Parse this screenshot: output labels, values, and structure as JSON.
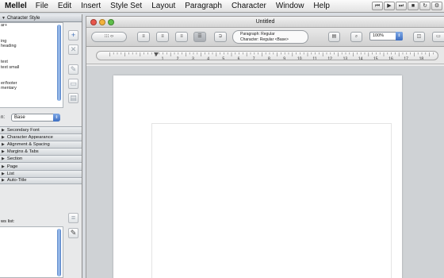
{
  "menubar": {
    "app": "Mellel",
    "items": [
      "File",
      "Edit",
      "Insert",
      "Style Set",
      "Layout",
      "Paragraph",
      "Character",
      "Window",
      "Help"
    ],
    "tray": [
      "⏮",
      "▶",
      "⏭",
      "■",
      "↻",
      "⚙"
    ]
  },
  "palette": {
    "header": "Character Style",
    "styles": [
      "ar+",
      "",
      "",
      "ing",
      "heading",
      "",
      "",
      "text",
      "text small",
      "",
      "",
      "er/footer",
      "mentary"
    ],
    "based_on_label": "n:",
    "based_on_value": "Base",
    "sections": [
      "Secondary Font",
      "Character Appearance",
      "Alignment & Spacing",
      "Margins & Tabs",
      "Section",
      "Page",
      "List",
      "Auto-Title"
    ],
    "list2_title": "ws list:"
  },
  "window": {
    "title": "Untitled",
    "paragraph_style": "Paragraph: Regular",
    "character_style": "Character: Regular <Base>",
    "zoom": "100%"
  },
  "ruler": {
    "numbers": [
      "1",
      "2",
      "3",
      "4",
      "5",
      "6",
      "7",
      "8",
      "9",
      "10",
      "11",
      "12",
      "13",
      "14",
      "15",
      "16",
      "17",
      "18"
    ]
  },
  "colors": {
    "accent": "#3d6ec1",
    "palette_bg": "#e8e9ea",
    "canvas": "#cfd2d5"
  }
}
